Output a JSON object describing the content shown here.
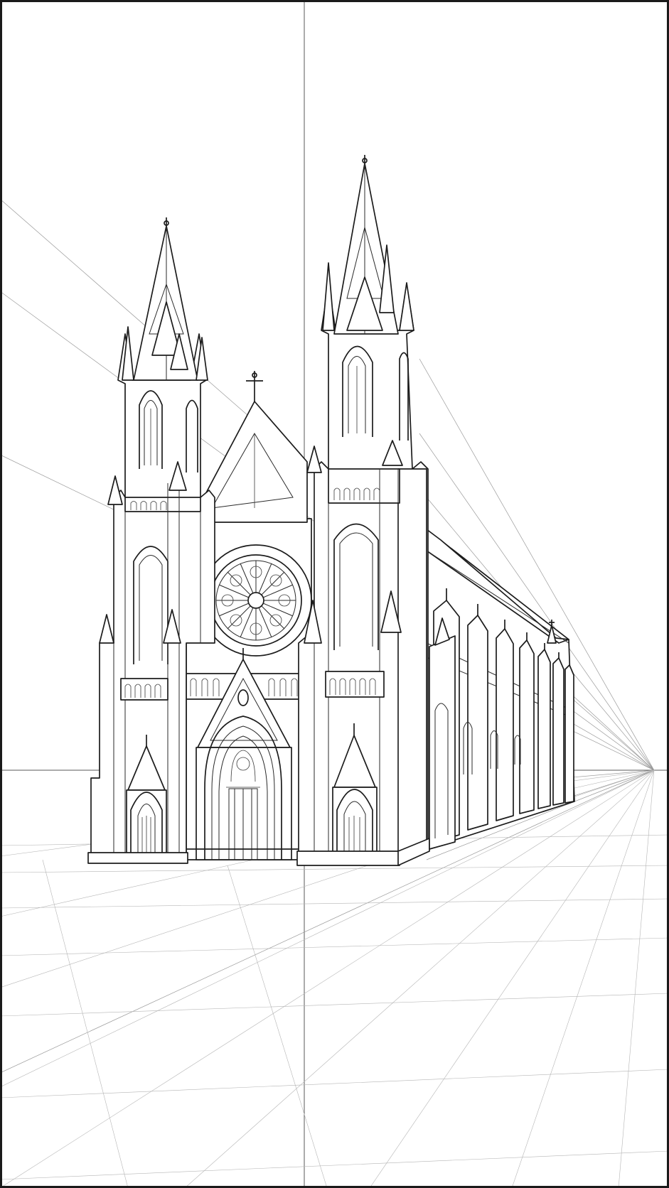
{
  "drawing": {
    "subject": "gothic-cathedral-two-point-perspective",
    "line_color": "#1c1c1c",
    "guide_color": "#9a9a9a",
    "background": "#ffffff"
  }
}
